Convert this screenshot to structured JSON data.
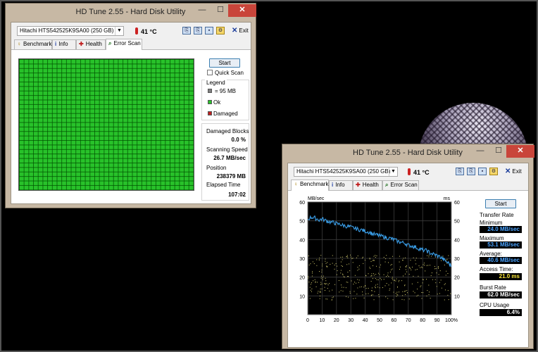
{
  "window1": {
    "title": "HD Tune 2.55 - Hard Disk Utility",
    "controls": {
      "minimize": "—",
      "maximize": "☐",
      "close": "✕"
    },
    "drive": "Hitachi HTS542525K9SA00 (250 GB)",
    "temperature": "41 °C",
    "exit_label": "Exit",
    "tabs": [
      {
        "label": "Benchmark",
        "icon": "benchmark-icon"
      },
      {
        "label": "Info",
        "icon": "info-icon"
      },
      {
        "label": "Health",
        "icon": "health-icon"
      },
      {
        "label": "Error Scan",
        "icon": "error-scan-icon"
      }
    ],
    "active_tab": "Error Scan",
    "start_label": "Start",
    "quick_scan_label": "Quick Scan",
    "quick_scan_checked": false,
    "legend": {
      "title": "Legend",
      "block_size": "= 95 MB",
      "ok": "Ok",
      "damaged": "Damaged",
      "block_color": "#808080",
      "ok_color": "#28c22a",
      "damaged_color": "#c02020"
    },
    "stats": {
      "damaged_blocks_label": "Damaged Blocks",
      "damaged_blocks_value": "0.0 %",
      "scanning_speed_label": "Scanning Speed",
      "scanning_speed_value": "26.7 MB/sec",
      "position_label": "Position",
      "position_value": "238379 MB",
      "elapsed_time_label": "Elapsed Time",
      "elapsed_time_value": "107:02"
    }
  },
  "window2": {
    "title": "HD Tune 2.55 - Hard Disk Utility",
    "controls": {
      "minimize": "—",
      "maximize": "☐",
      "close": "✕"
    },
    "drive": "Hitachi HTS542525K9SA00 (250 GB)",
    "temperature": "41 °C",
    "exit_label": "Exit",
    "tabs": [
      {
        "label": "Benchmark",
        "icon": "benchmark-icon"
      },
      {
        "label": "Info",
        "icon": "info-icon"
      },
      {
        "label": "Health",
        "icon": "health-icon"
      },
      {
        "label": "Error Scan",
        "icon": "error-scan-icon"
      }
    ],
    "active_tab": "Benchmark",
    "start_label": "Start",
    "transfer_rate_title": "Transfer Rate",
    "minimum_label": "Minimum",
    "minimum_value": "24.0 MB/sec",
    "maximum_label": "Maximum",
    "maximum_value": "53.1 MB/sec",
    "average_label": "Average:",
    "average_value": "40.6 MB/sec",
    "access_time_label": "Access Time:",
    "access_time_value": "21.0 ms",
    "burst_rate_label": "Burst Rate",
    "burst_rate_value": "62.0 MB/sec",
    "cpu_usage_label": "CPU Usage",
    "cpu_usage_value": "6.4%"
  },
  "chart_data": {
    "type": "line",
    "title": "",
    "ylabel": "MB/sec",
    "y2label": "ms",
    "xlabel": "",
    "ylim": [
      0,
      60
    ],
    "y2lim": [
      0,
      60
    ],
    "xlim": [
      0,
      100
    ],
    "yticks": [
      10,
      20,
      30,
      40,
      50,
      60
    ],
    "y2ticks": [
      10,
      20,
      30,
      40,
      50,
      60
    ],
    "xticks": [
      "0",
      "10",
      "20",
      "30",
      "40",
      "50",
      "60",
      "70",
      "80",
      "90",
      "100%"
    ],
    "grid": true,
    "series": [
      {
        "kind": "line",
        "color": "#3a9ee8",
        "x": [
          0,
          3,
          5,
          8,
          10,
          13,
          15,
          18,
          20,
          23,
          25,
          28,
          30,
          33,
          35,
          38,
          40,
          43,
          45,
          48,
          50,
          53,
          55,
          58,
          60,
          63,
          65,
          68,
          70,
          73,
          75,
          78,
          80,
          83,
          85,
          88,
          90,
          93,
          95,
          98,
          100
        ],
        "values": [
          51,
          52,
          51.5,
          50.5,
          51,
          50,
          49.5,
          49,
          48.5,
          48,
          47.5,
          47,
          46.5,
          46,
          45.5,
          45,
          44.5,
          44,
          43,
          42.5,
          42,
          41.5,
          41,
          40.5,
          40,
          39,
          38.5,
          38,
          37,
          36.5,
          36,
          35,
          34.5,
          34,
          33,
          32,
          31.5,
          30.5,
          29,
          27.5,
          26
        ]
      },
      {
        "kind": "scatter",
        "color": "#d8d070",
        "description_points_range_ms": [
          8,
          32
        ]
      }
    ]
  }
}
